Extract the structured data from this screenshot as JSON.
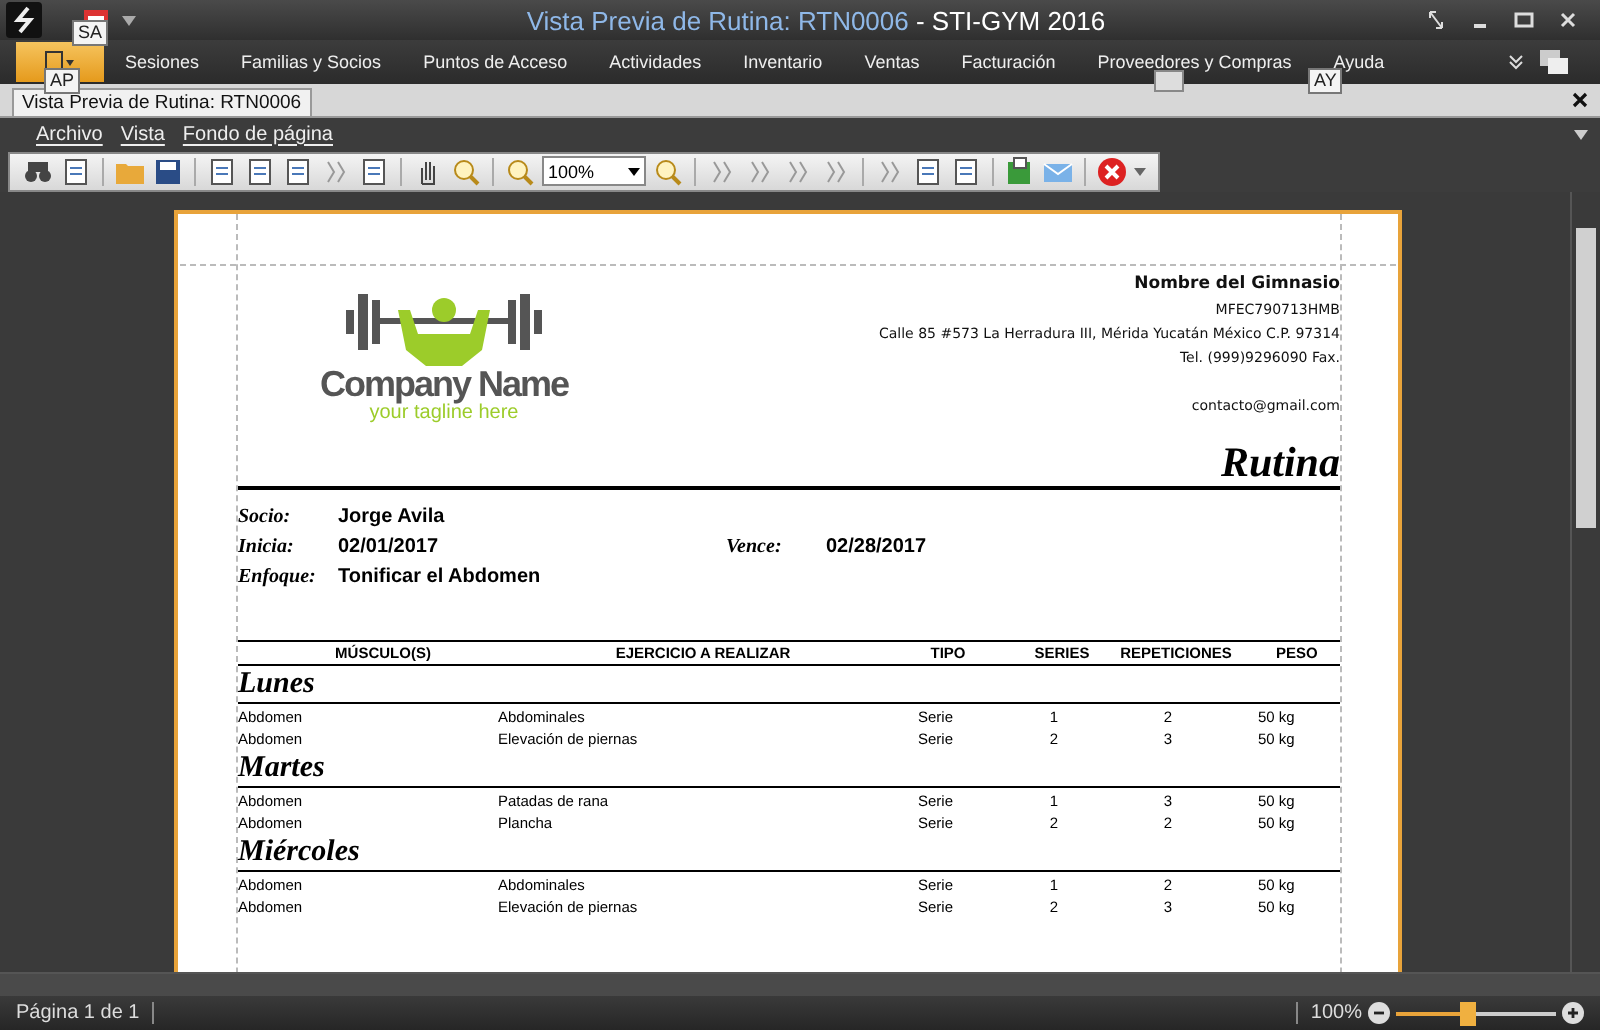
{
  "window": {
    "title_main": "Vista Previa de Rutina: RTN0006",
    "title_app": " - STI-GYM 2016"
  },
  "keytips": [
    {
      "label": "SA"
    },
    {
      "label": "AP"
    },
    {
      "label": "AY"
    }
  ],
  "ribbon_tabs": [
    "Sesiones",
    "Familias y Socios",
    "Puntos de Acceso",
    "Actividades",
    "Inventario",
    "Ventas",
    "Facturación",
    "Proveedores y Compras",
    "Ayuda"
  ],
  "document_tab": {
    "label": "Vista Previa de Rutina: RTN0006"
  },
  "menu": [
    "Archivo",
    "Vista",
    "Fondo de página"
  ],
  "zoom_combo": {
    "value": "100%"
  },
  "report": {
    "logo": {
      "name": "Company Name",
      "tagline": "your tagline here"
    },
    "company": {
      "name": "Nombre del Gimnasio",
      "rfc": "MFEC790713HMB",
      "address": "Calle 85 #573  La Herradura III, Mérida Yucatán México C.P. 97314",
      "phone": "Tel. (999)9296090 Fax.",
      "email": "contacto@gmail.com"
    },
    "title": "Rutina",
    "fields": [
      {
        "label": "Socio:",
        "value": "Jorge Avila"
      },
      {
        "label": "Inicia:",
        "value": "02/01/2017"
      },
      {
        "label": "Vence:",
        "value": "02/28/2017"
      },
      {
        "label": "Enfoque:",
        "value": "Tonificar el Abdomen"
      }
    ],
    "columns": [
      "MÚSCULO(S)",
      "EJERCICIO A REALIZAR",
      "TIPO",
      "SERIES",
      "REPETICIONES",
      "PESO"
    ],
    "days": [
      {
        "name": "Lunes",
        "rows": [
          [
            "Abdomen",
            "Abdominales",
            "Serie",
            "1",
            "2",
            "50 kg"
          ],
          [
            "Abdomen",
            "Elevación de piernas",
            "Serie",
            "2",
            "3",
            "50 kg"
          ]
        ]
      },
      {
        "name": "Martes",
        "rows": [
          [
            "Abdomen",
            "Patadas de rana",
            "Serie",
            "1",
            "3",
            "50 kg"
          ],
          [
            "Abdomen",
            "Plancha",
            "Serie",
            "2",
            "2",
            "50 kg"
          ]
        ]
      },
      {
        "name": "Miércoles",
        "rows": [
          [
            "Abdomen",
            "Abdominales",
            "Serie",
            "1",
            "2",
            "50 kg"
          ],
          [
            "Abdomen",
            "Elevación de piernas",
            "Serie",
            "2",
            "3",
            "50 kg"
          ]
        ]
      }
    ]
  },
  "status_bar": {
    "page": "Página 1 de 1",
    "zoom": "100%",
    "zoom_slider": {
      "level": 0.45
    }
  }
}
